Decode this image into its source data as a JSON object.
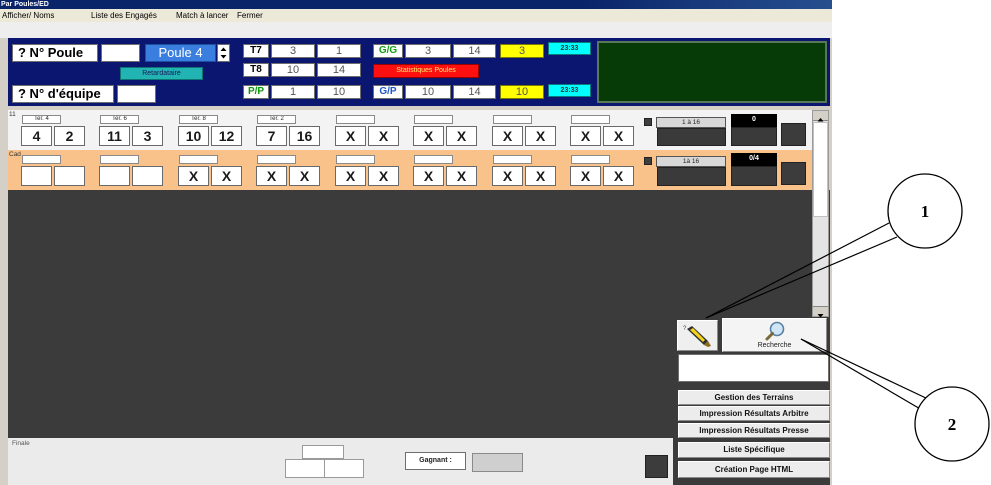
{
  "window": {
    "title": "Par Poules/ED"
  },
  "menu": {
    "items": [
      "Afficher/ Noms",
      "Liste des Engagés",
      "Match à lancer",
      "Fermer"
    ]
  },
  "top_panel": {
    "poule_label": "? N° Poule",
    "poule_value": "",
    "poule_select": "Poule 4",
    "retardataire": "Retardataire",
    "equipe_label": "? N° d'équipe",
    "equipe_value": "",
    "t_rows": [
      {
        "label": "T7",
        "values": [
          "3",
          "1"
        ]
      },
      {
        "label": "T8",
        "values": [
          "10",
          "14"
        ]
      },
      {
        "label": "P/P",
        "values": [
          "1",
          "10"
        ]
      }
    ],
    "g_rows": [
      {
        "label": "G/G",
        "values": [
          "3",
          "14"
        ],
        "highlight": "3",
        "time": "23:33"
      },
      {
        "label": "G/P",
        "values": [
          "10",
          "14"
        ],
        "highlight": "10",
        "time": "23:33"
      }
    ],
    "stats_button": "Statistiques Poules"
  },
  "rows": [
    {
      "label": "11",
      "range": "1 à 16",
      "counter": "0",
      "groups": [
        {
          "header": "Ter. 4",
          "values": [
            "4",
            "2"
          ]
        },
        {
          "header": "Ter. 6",
          "values": [
            "11",
            "3"
          ]
        },
        {
          "header": "Ter. 8",
          "values": [
            "10",
            "12"
          ]
        },
        {
          "header": "Ter. 2",
          "values": [
            "7",
            "16"
          ]
        },
        {
          "header": "",
          "values": [
            "X",
            "X"
          ]
        },
        {
          "header": "",
          "values": [
            "X",
            "X"
          ]
        },
        {
          "header": "",
          "values": [
            "X",
            "X"
          ]
        },
        {
          "header": "",
          "values": [
            "X",
            "X"
          ]
        }
      ]
    },
    {
      "label": "Cad",
      "range": "1à 16",
      "counter": "0/4",
      "groups": [
        {
          "header": "",
          "values": [
            "",
            ""
          ]
        },
        {
          "header": "",
          "values": [
            "",
            ""
          ]
        },
        {
          "header": "",
          "values": [
            "X",
            "X"
          ]
        },
        {
          "header": "",
          "values": [
            "X",
            "X"
          ]
        },
        {
          "header": "",
          "values": [
            "X",
            "X"
          ]
        },
        {
          "header": "",
          "values": [
            "X",
            "X"
          ]
        },
        {
          "header": "",
          "values": [
            "X",
            "X"
          ]
        },
        {
          "header": "",
          "values": [
            "X",
            "X"
          ]
        }
      ]
    }
  ],
  "right_panel": {
    "search_button": "Recherche",
    "search_value": "",
    "buttons": [
      "Gestion des Terrains",
      "Impression Résultats Arbitre",
      "Impression Résultats Presse",
      "Liste Spécifique",
      "Création Page HTML"
    ]
  },
  "finale": {
    "label": "Finale",
    "winner_label": "Gagnant :",
    "winner_value": ""
  },
  "callouts": {
    "first": "1",
    "second": "2"
  },
  "icons": {
    "tool_button": "marker-icon",
    "search": "magnifier-icon",
    "spinner": "spinner-arrows-icon",
    "scroll_up": "arrow-up-icon",
    "scroll_down": "arrow-down-icon"
  },
  "colors": {
    "panel": "#0a1670",
    "poule_select": "#3a7fe0",
    "retardataire": "#22b3b3",
    "stats_button": "#ff1010",
    "highlight": "#ffff00",
    "time": "#00ffff",
    "cad_row": "#f8c28a",
    "dark_area": "#3b3b3b",
    "green_panel": "#063a06"
  }
}
